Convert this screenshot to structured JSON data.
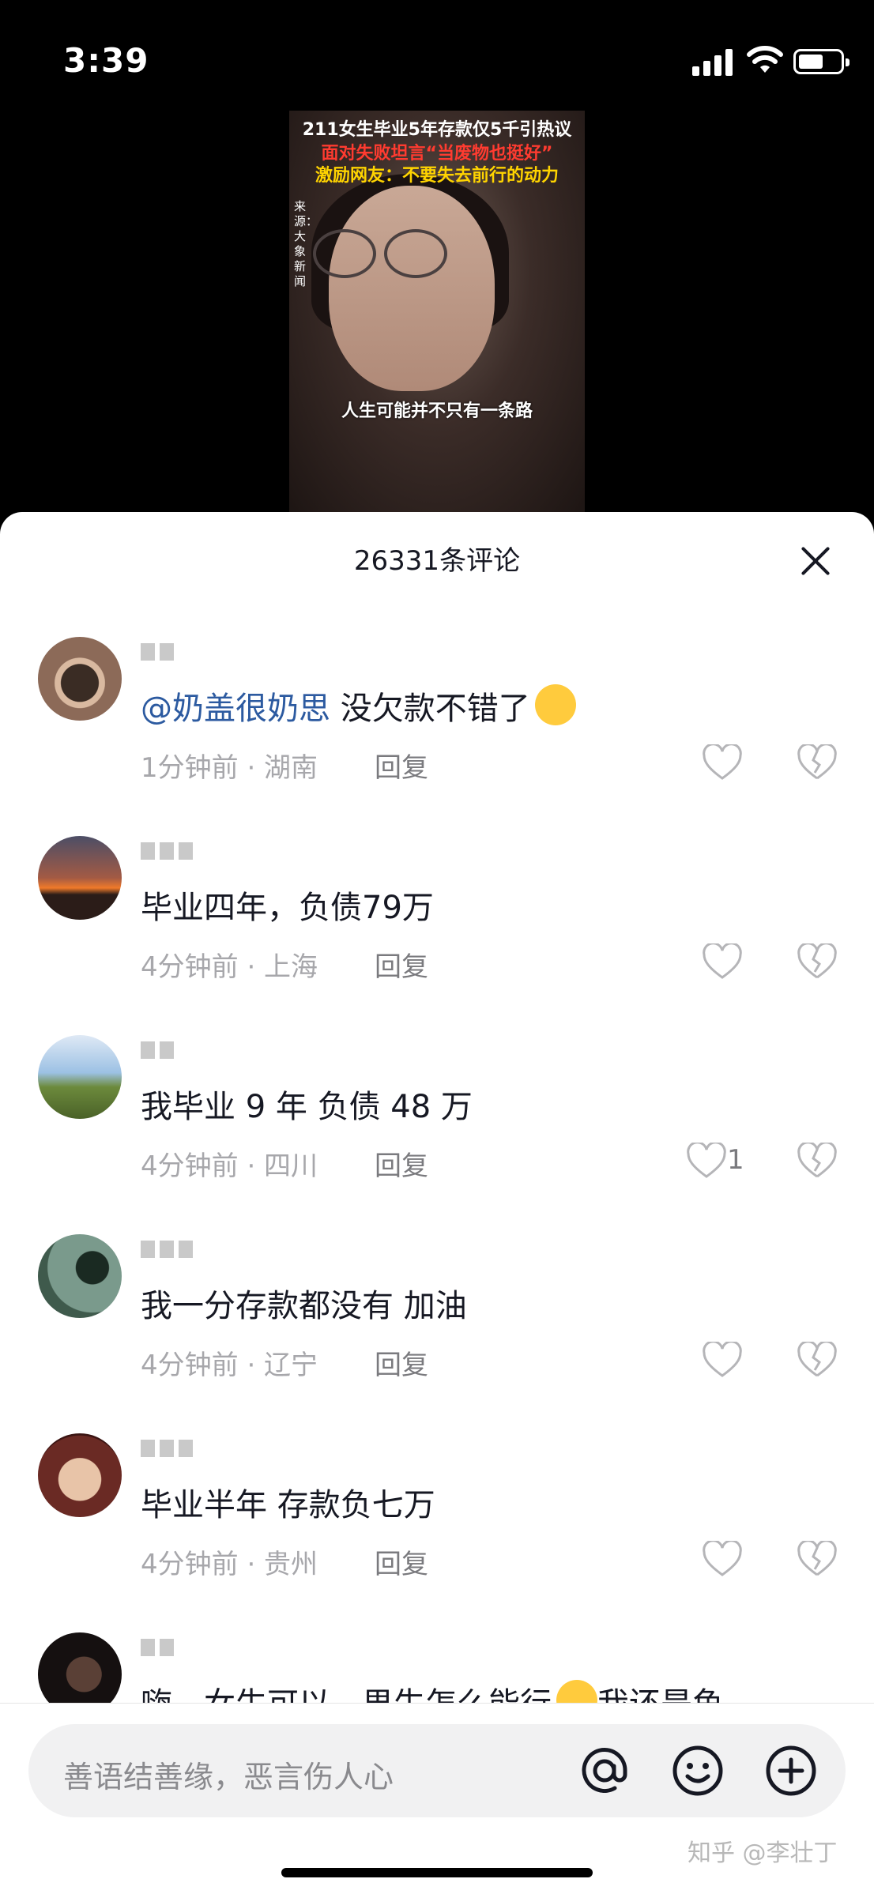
{
  "status_bar": {
    "time": "3:39"
  },
  "video": {
    "caption_line1": "211女生毕业5年存款仅5千引热议",
    "caption_line2": "面对失败坦言“当废物也挺好”",
    "caption_line3": "激励网友：不要失去前行的动力",
    "source": "来源：大象新闻",
    "subtitle": "人生可能并不只有一条路"
  },
  "sheet": {
    "title": "26331条评论"
  },
  "comments": [
    {
      "mention": "@奶盖很奶思",
      "text": " 没欠款不错了",
      "time_location": "1分钟前 · 湖南",
      "reply": "回复",
      "likes": ""
    },
    {
      "mention": "",
      "text": "毕业四年，负债79万",
      "time_location": "4分钟前 · 上海",
      "reply": "回复",
      "likes": ""
    },
    {
      "mention": "",
      "text": "我毕业 9 年 负债 48 万",
      "time_location": "4分钟前 · 四川",
      "reply": "回复",
      "likes": "1"
    },
    {
      "mention": "",
      "text": "我一分存款都没有 加油",
      "time_location": "4分钟前 · 辽宁",
      "reply": "回复",
      "likes": ""
    },
    {
      "mention": "",
      "text": "毕业半年 存款负七万",
      "time_location": "4分钟前 · 贵州",
      "reply": "回复",
      "likes": ""
    },
    {
      "mention": "",
      "text": "嗨，女生可以，男生怎么能行",
      "text_tail": "我还是鱼",
      "time_location": "",
      "reply": "",
      "likes": ""
    }
  ],
  "input": {
    "placeholder": "善语结善缘，恶言伤人心"
  },
  "watermark": "知乎 @李壮丁",
  "icons": [
    "close-icon",
    "heart-icon",
    "broken-heart-icon",
    "at-icon",
    "emoji-icon",
    "add-icon"
  ]
}
